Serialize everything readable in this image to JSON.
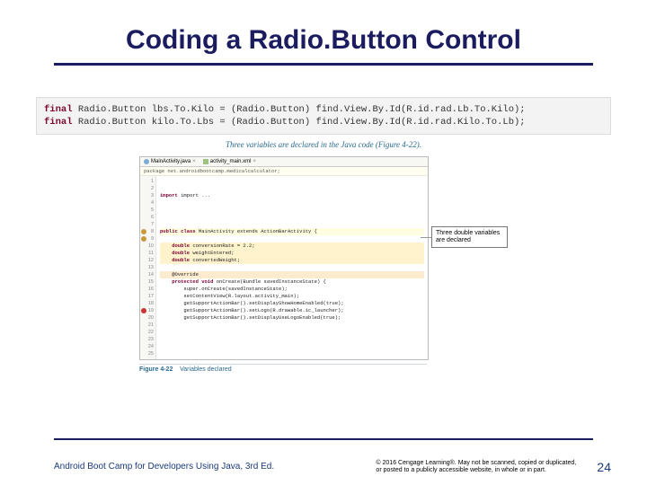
{
  "title": "Coding a Radio.Button Control",
  "snippet": {
    "line1": {
      "kw": "final",
      "rest": " Radio.Button lbs.To.Kilo = (Radio.Button) find.View.By.Id(R.id.rad.Lb.To.Kilo);"
    },
    "line2": {
      "kw": "final",
      "rest": " Radio.Button kilo.To.Lbs = (Radio.Button) find.View.By.Id(R.id.rad.Kilo.To.Lb);"
    }
  },
  "caption1": "Three variables are declared in the Java code (Figure 4-22).",
  "ide": {
    "tab1": "MainActivity.java",
    "tab2": "activity_main.xml",
    "close": "×",
    "pkg": "package net.androidbootcamp.medicalcalculator;",
    "lines": [
      "1",
      "2",
      "3",
      "4",
      "5",
      "6",
      "7",
      "8",
      "9",
      "10",
      "11",
      "12",
      "13",
      "14",
      "15",
      "16",
      "17",
      "18",
      "19",
      "20",
      "21",
      "22",
      "23",
      "24",
      "25"
    ],
    "code": {
      "l3": "import ...",
      "l8": {
        "pre": "public class ",
        "mid": "MainActivity",
        "post": " extends ActionBarActivity {"
      },
      "l10": {
        "kw": "double",
        "rest": " conversionRate = 2.2;"
      },
      "l11": {
        "kw": "double",
        "rest": " weightEntered;"
      },
      "l12": {
        "kw": "double",
        "rest": " convertedWeight;"
      },
      "l14": "@Override",
      "l15": {
        "pre": "protected void ",
        "mid": "onCreate",
        "post": "(Bundle savedInstanceState) {"
      },
      "l16": "super.onCreate(savedInstanceState);",
      "l17": "setContentView(R.layout.activity_main);",
      "l18": "getSupportActionBar().setDisplayShowHomeEnabled(true);",
      "l19": "getSupportActionBar().setLogo(R.drawable.ic_launcher);",
      "l20": "getSupportActionBar().setDisplayUseLogoEnabled(true);"
    }
  },
  "annotation": "Three double variables are declared",
  "figure": {
    "label": "Figure 4-22",
    "text": "Variables declared"
  },
  "footer": {
    "left": "Android Boot Camp for Developers Using Java, 3rd Ed.",
    "copyright": "© 2016 Cengage Learning®. May not be scanned, copied or duplicated, or posted to a publicly accessible website, in whole or in part.",
    "page": "24"
  }
}
